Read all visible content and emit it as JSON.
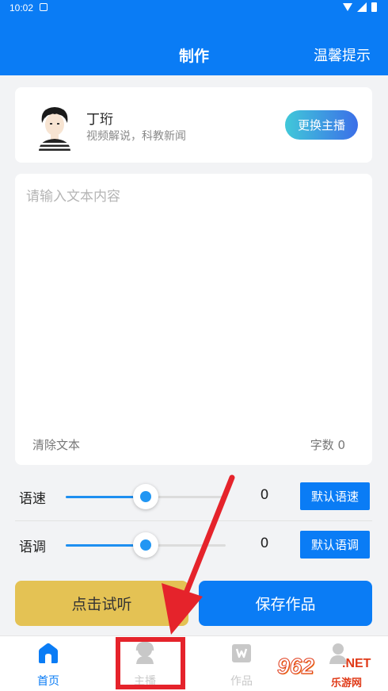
{
  "status_bar": {
    "time": "10:02"
  },
  "header": {
    "title": "制作",
    "tips_label": "温馨提示"
  },
  "anchor": {
    "name": "丁珩",
    "description": "视频解说，科教新闻",
    "change_label": "更换主播"
  },
  "editor": {
    "placeholder": "请输入文本内容",
    "value": "",
    "clear_label": "清除文本",
    "count_label": "字数 0"
  },
  "controls": [
    {
      "label": "语速",
      "value": "0",
      "level": 0.5,
      "default_label": "默认语速"
    },
    {
      "label": "语调",
      "value": "0",
      "level": 0.5,
      "default_label": "默认语调"
    }
  ],
  "actions": {
    "listen_label": "点击试听",
    "save_label": "保存作品"
  },
  "nav": [
    {
      "label": "首页",
      "icon": "home-icon",
      "active": true
    },
    {
      "label": "主播",
      "icon": "anchor-icon",
      "active": false
    },
    {
      "label": "作品",
      "icon": "works-icon",
      "active": false
    },
    {
      "label": "",
      "icon": "profile-icon",
      "active": false
    }
  ],
  "watermark": {
    "badge": "962",
    "suffix": ".NET",
    "site": "乐游网"
  },
  "colors": {
    "primary": "#0a7cf5",
    "listen": "#e4c254",
    "highlight": "#e5232b"
  }
}
